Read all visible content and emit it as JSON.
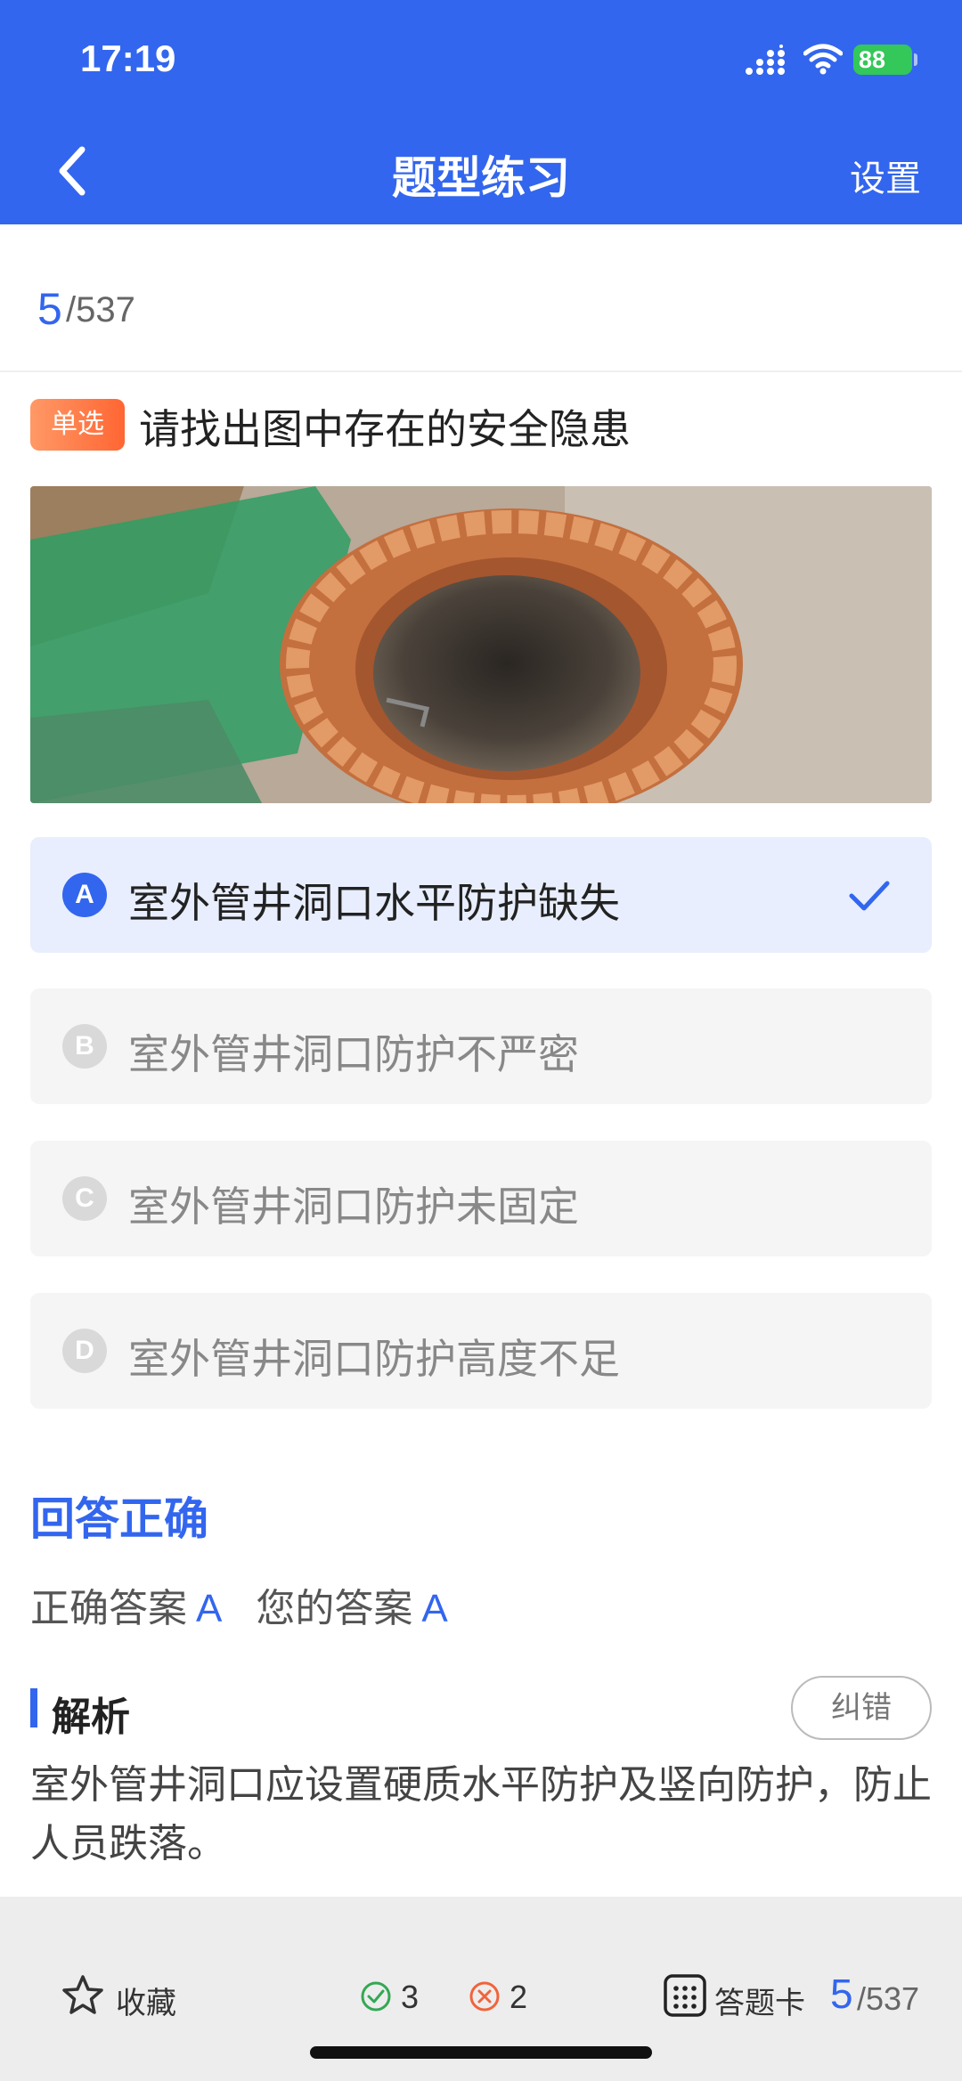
{
  "status_bar": {
    "time": "17:19",
    "battery": "88"
  },
  "nav": {
    "title": "题型练习",
    "settings": "设置"
  },
  "progress": {
    "current": "5",
    "total": "/537"
  },
  "question": {
    "type": "单选",
    "text": "请找出图中存在的安全隐患",
    "options": [
      {
        "letter": "A",
        "text": "室外管井洞口水平防护缺失",
        "selected": true
      },
      {
        "letter": "B",
        "text": "室外管井洞口防护不严密",
        "selected": false
      },
      {
        "letter": "C",
        "text": "室外管井洞口防护未固定",
        "selected": false
      },
      {
        "letter": "D",
        "text": "室外管井洞口防护高度不足",
        "selected": false
      }
    ]
  },
  "result": {
    "title": "回答正确",
    "correct_label": "正确答案",
    "correct_value": "A",
    "yours_label": "您的答案",
    "yours_value": "A"
  },
  "analysis": {
    "title": "解析",
    "report_button": "纠错",
    "text": "室外管井洞口应设置硬质水平防护及竖向防护，防止人员跌落。"
  },
  "bottom_bar": {
    "favorite": "收藏",
    "correct_count": "3",
    "wrong_count": "2",
    "answer_card": "答题卡",
    "current": "5",
    "total": "/537"
  },
  "colors": {
    "primary": "#3366EE",
    "tag_gradient_start": "#FF9966",
    "tag_gradient_end": "#FF6633",
    "correct_green": "#34A853",
    "wrong_red": "#F0643C"
  },
  "icons": {
    "back": "chevron-left-icon",
    "check": "check-icon",
    "favorite": "star-outline-icon",
    "correct": "check-circle-icon",
    "wrong": "x-circle-icon",
    "answer_card": "grid-icon"
  }
}
